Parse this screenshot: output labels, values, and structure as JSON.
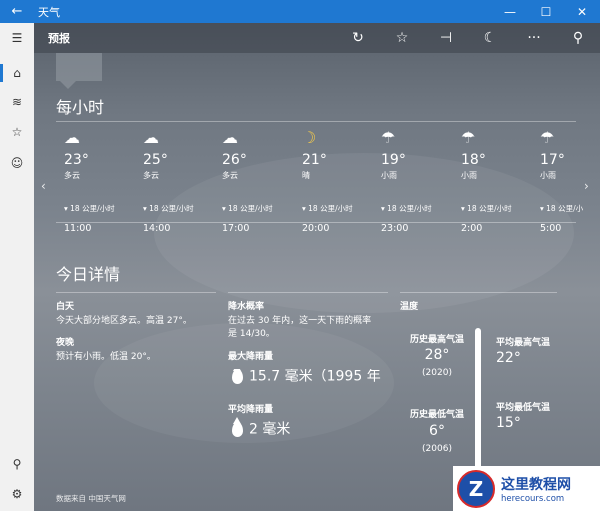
{
  "titlebar": {
    "back_glyph": "←",
    "title": "天气",
    "minimize": "—",
    "maximize": "☐",
    "close": "✕"
  },
  "sidebar": {
    "items": [
      {
        "name": "hamburger-menu-icon",
        "glyph": "☰"
      },
      {
        "name": "home-icon",
        "glyph": "⌂"
      },
      {
        "name": "chart-icon",
        "glyph": "≋"
      },
      {
        "name": "favorites-list-icon",
        "glyph": "☆"
      },
      {
        "name": "smiley-icon",
        "glyph": "☺"
      }
    ],
    "bottom": [
      {
        "name": "account-icon",
        "glyph": "⚲"
      },
      {
        "name": "settings-gear-icon",
        "glyph": "⚙"
      }
    ]
  },
  "toolbar": {
    "title": "预报",
    "refresh_icon": "↻",
    "favorite_icon": "☆",
    "pin_icon": "⊣",
    "night_mode_icon": "☾",
    "more_icon": "···",
    "search_icon": "⚲"
  },
  "hourly": {
    "heading": "每小时",
    "prev_arrow": "‹",
    "next_arrow": "›",
    "items": [
      {
        "icon": "cloudy-icon",
        "glyph": "☁",
        "temp": "23°",
        "cond": "多云",
        "wind": "▾ 18 公里/小时",
        "time": "11:00"
      },
      {
        "icon": "cloudy-icon",
        "glyph": "☁",
        "temp": "25°",
        "cond": "多云",
        "wind": "▾ 18 公里/小时",
        "time": "14:00"
      },
      {
        "icon": "cloudy-icon",
        "glyph": "☁",
        "temp": "26°",
        "cond": "多云",
        "wind": "▾ 18 公里/小时",
        "time": "17:00"
      },
      {
        "icon": "moon-icon",
        "glyph": "☽",
        "temp": "21°",
        "cond": "晴",
        "wind": "▾ 18 公里/小时",
        "time": "20:00"
      },
      {
        "icon": "light-rain-icon",
        "glyph": "☂",
        "temp": "19°",
        "cond": "小雨",
        "wind": "▾ 18 公里/小时",
        "time": "23:00"
      },
      {
        "icon": "light-rain-icon",
        "glyph": "☂",
        "temp": "18°",
        "cond": "小雨",
        "wind": "▾ 18 公里/小时",
        "time": "2:00"
      },
      {
        "icon": "light-rain-icon",
        "glyph": "☂",
        "temp": "17°",
        "cond": "小雨",
        "wind": "▾ 18 公里/小",
        "time": "5:00"
      }
    ]
  },
  "details": {
    "heading": "今日详情",
    "day_label": "白天",
    "day_text": "今天大部分地区多云。高温 27°。",
    "night_label": "夜晚",
    "night_text": "预计有小雨。低温 20°。",
    "precip_label": "降水概率",
    "precip_text_1": "在过去 30 年内，这一天下雨的概率",
    "precip_text_2": "是 14/30。",
    "max_rain_label": "最大降雨量",
    "max_rain_value": "15.7 毫米（1995 年",
    "avg_rain_label": "平均降雨量",
    "avg_rain_value": "2 毫米",
    "temp_label": "温度",
    "hist_high_label": "历史最高气温",
    "hist_high_value": "28°",
    "hist_high_year": "(2020)",
    "avg_high_label": "平均最高气温",
    "avg_high_value": "22°",
    "hist_low_label": "历史最低气温",
    "hist_low_value": "6°",
    "hist_low_year": "(2006)",
    "avg_low_label": "平均最低气温",
    "avg_low_value": "15°",
    "source": "数据来自 中国天气网"
  },
  "watermark": {
    "logo_letter": "Z",
    "cn": "这里教程网",
    "url": "herecours.com"
  }
}
